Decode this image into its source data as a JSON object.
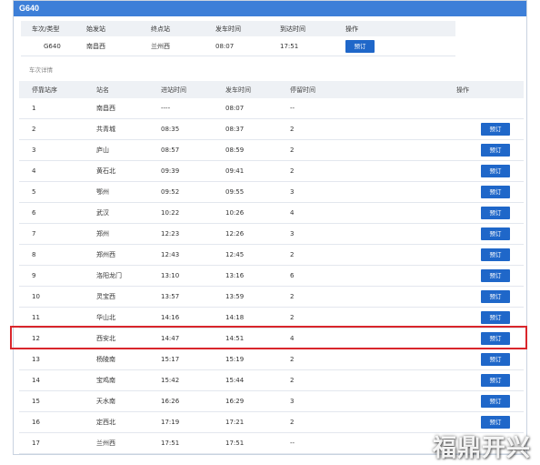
{
  "panel": {
    "title": "G640"
  },
  "summary": {
    "headers": {
      "train": "车次/类型",
      "start": "始发站",
      "end": "终点站",
      "depart": "发车时间",
      "arrive": "到达时间",
      "action": "操作"
    },
    "row": {
      "train": "G640",
      "start": "南昌西",
      "end": "兰州西",
      "depart": "08:07",
      "arrive": "17:51",
      "button": "预订"
    }
  },
  "detail_label": "车次详情",
  "table": {
    "headers": {
      "seq": "停靠站序",
      "station": "站名",
      "arrive": "进站时间",
      "depart": "发车时间",
      "stay": "停留时间",
      "action": "操作"
    },
    "rows": [
      {
        "seq": "1",
        "station": "南昌西",
        "arrive": "----",
        "depart": "08:07",
        "stay": "--",
        "button": ""
      },
      {
        "seq": "2",
        "station": "共青城",
        "arrive": "08:35",
        "depart": "08:37",
        "stay": "2",
        "button": "预订"
      },
      {
        "seq": "3",
        "station": "庐山",
        "arrive": "08:57",
        "depart": "08:59",
        "stay": "2",
        "button": "预订"
      },
      {
        "seq": "4",
        "station": "黄石北",
        "arrive": "09:39",
        "depart": "09:41",
        "stay": "2",
        "button": "预订"
      },
      {
        "seq": "5",
        "station": "鄂州",
        "arrive": "09:52",
        "depart": "09:55",
        "stay": "3",
        "button": "预订"
      },
      {
        "seq": "6",
        "station": "武汉",
        "arrive": "10:22",
        "depart": "10:26",
        "stay": "4",
        "button": "预订"
      },
      {
        "seq": "7",
        "station": "郑州",
        "arrive": "12:23",
        "depart": "12:26",
        "stay": "3",
        "button": "预订"
      },
      {
        "seq": "8",
        "station": "郑州西",
        "arrive": "12:43",
        "depart": "12:45",
        "stay": "2",
        "button": "预订"
      },
      {
        "seq": "9",
        "station": "洛阳龙门",
        "arrive": "13:10",
        "depart": "13:16",
        "stay": "6",
        "button": "预订"
      },
      {
        "seq": "10",
        "station": "灵宝西",
        "arrive": "13:57",
        "depart": "13:59",
        "stay": "2",
        "button": "预订"
      },
      {
        "seq": "11",
        "station": "华山北",
        "arrive": "14:16",
        "depart": "14:18",
        "stay": "2",
        "button": "预订"
      },
      {
        "seq": "12",
        "station": "西安北",
        "arrive": "14:47",
        "depart": "14:51",
        "stay": "4",
        "button": "预订"
      },
      {
        "seq": "13",
        "station": "杨陵南",
        "arrive": "15:17",
        "depart": "15:19",
        "stay": "2",
        "button": "预订"
      },
      {
        "seq": "14",
        "station": "宝鸡南",
        "arrive": "15:42",
        "depart": "15:44",
        "stay": "2",
        "button": "预订"
      },
      {
        "seq": "15",
        "station": "天水南",
        "arrive": "16:26",
        "depart": "16:29",
        "stay": "3",
        "button": "预订"
      },
      {
        "seq": "16",
        "station": "定西北",
        "arrive": "17:19",
        "depart": "17:21",
        "stay": "2",
        "button": "预订"
      },
      {
        "seq": "17",
        "station": "兰州西",
        "arrive": "17:51",
        "depart": "17:51",
        "stay": "--",
        "button": ""
      }
    ]
  },
  "watermark": "福鼎开兴",
  "colors": {
    "header_blue": "#3d7fd8",
    "button_blue": "#1f67c9",
    "highlight_red": "#d9262c",
    "table_head_bg": "#eef1f5"
  }
}
